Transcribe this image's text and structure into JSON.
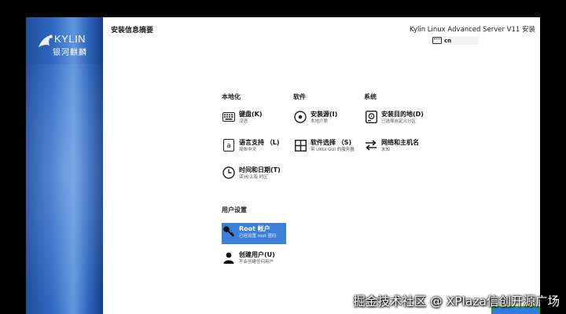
{
  "sidebar": {
    "logo_en": "KYLIN",
    "logo_cn": "银河麒麟"
  },
  "header": {
    "title": "安装信息摘要",
    "product": "Kylin Linux Advanced Server V11 安装",
    "keyboard_layout": "cn"
  },
  "sections": {
    "localization": {
      "title": "本地化",
      "keyboard": {
        "label": "键盘(K)",
        "status": "汉语"
      },
      "language": {
        "label": "语言支持 （L)",
        "status": "简体中文"
      },
      "time": {
        "label": "时间和日期(T)",
        "status": "亚洲/上海 时区"
      }
    },
    "software": {
      "title": "软件",
      "source": {
        "label": "安装源(I)",
        "status": "本地介质"
      },
      "selection": {
        "label": "软件选择 （S)",
        "status": "带 UKUI GUI 的服务器"
      }
    },
    "system": {
      "title": "系统",
      "destination": {
        "label": "安装目的地(D)",
        "status": "已选择自定义分区"
      },
      "network": {
        "label": "网络和主机名",
        "status": "未知"
      }
    },
    "user": {
      "title": "用户设置",
      "root": {
        "label": "Root 帐户",
        "status": "已经设置 root 密码"
      },
      "create_user": {
        "label": "创建用户(U)",
        "status": "不会创建任何用户"
      }
    }
  },
  "watermark": "掘金技术社区 @ XPlaza信创开源广场",
  "colors": {
    "accent": "#3c80d8",
    "sidebar": "#2f69c2",
    "focus_border": "#22a32a"
  }
}
